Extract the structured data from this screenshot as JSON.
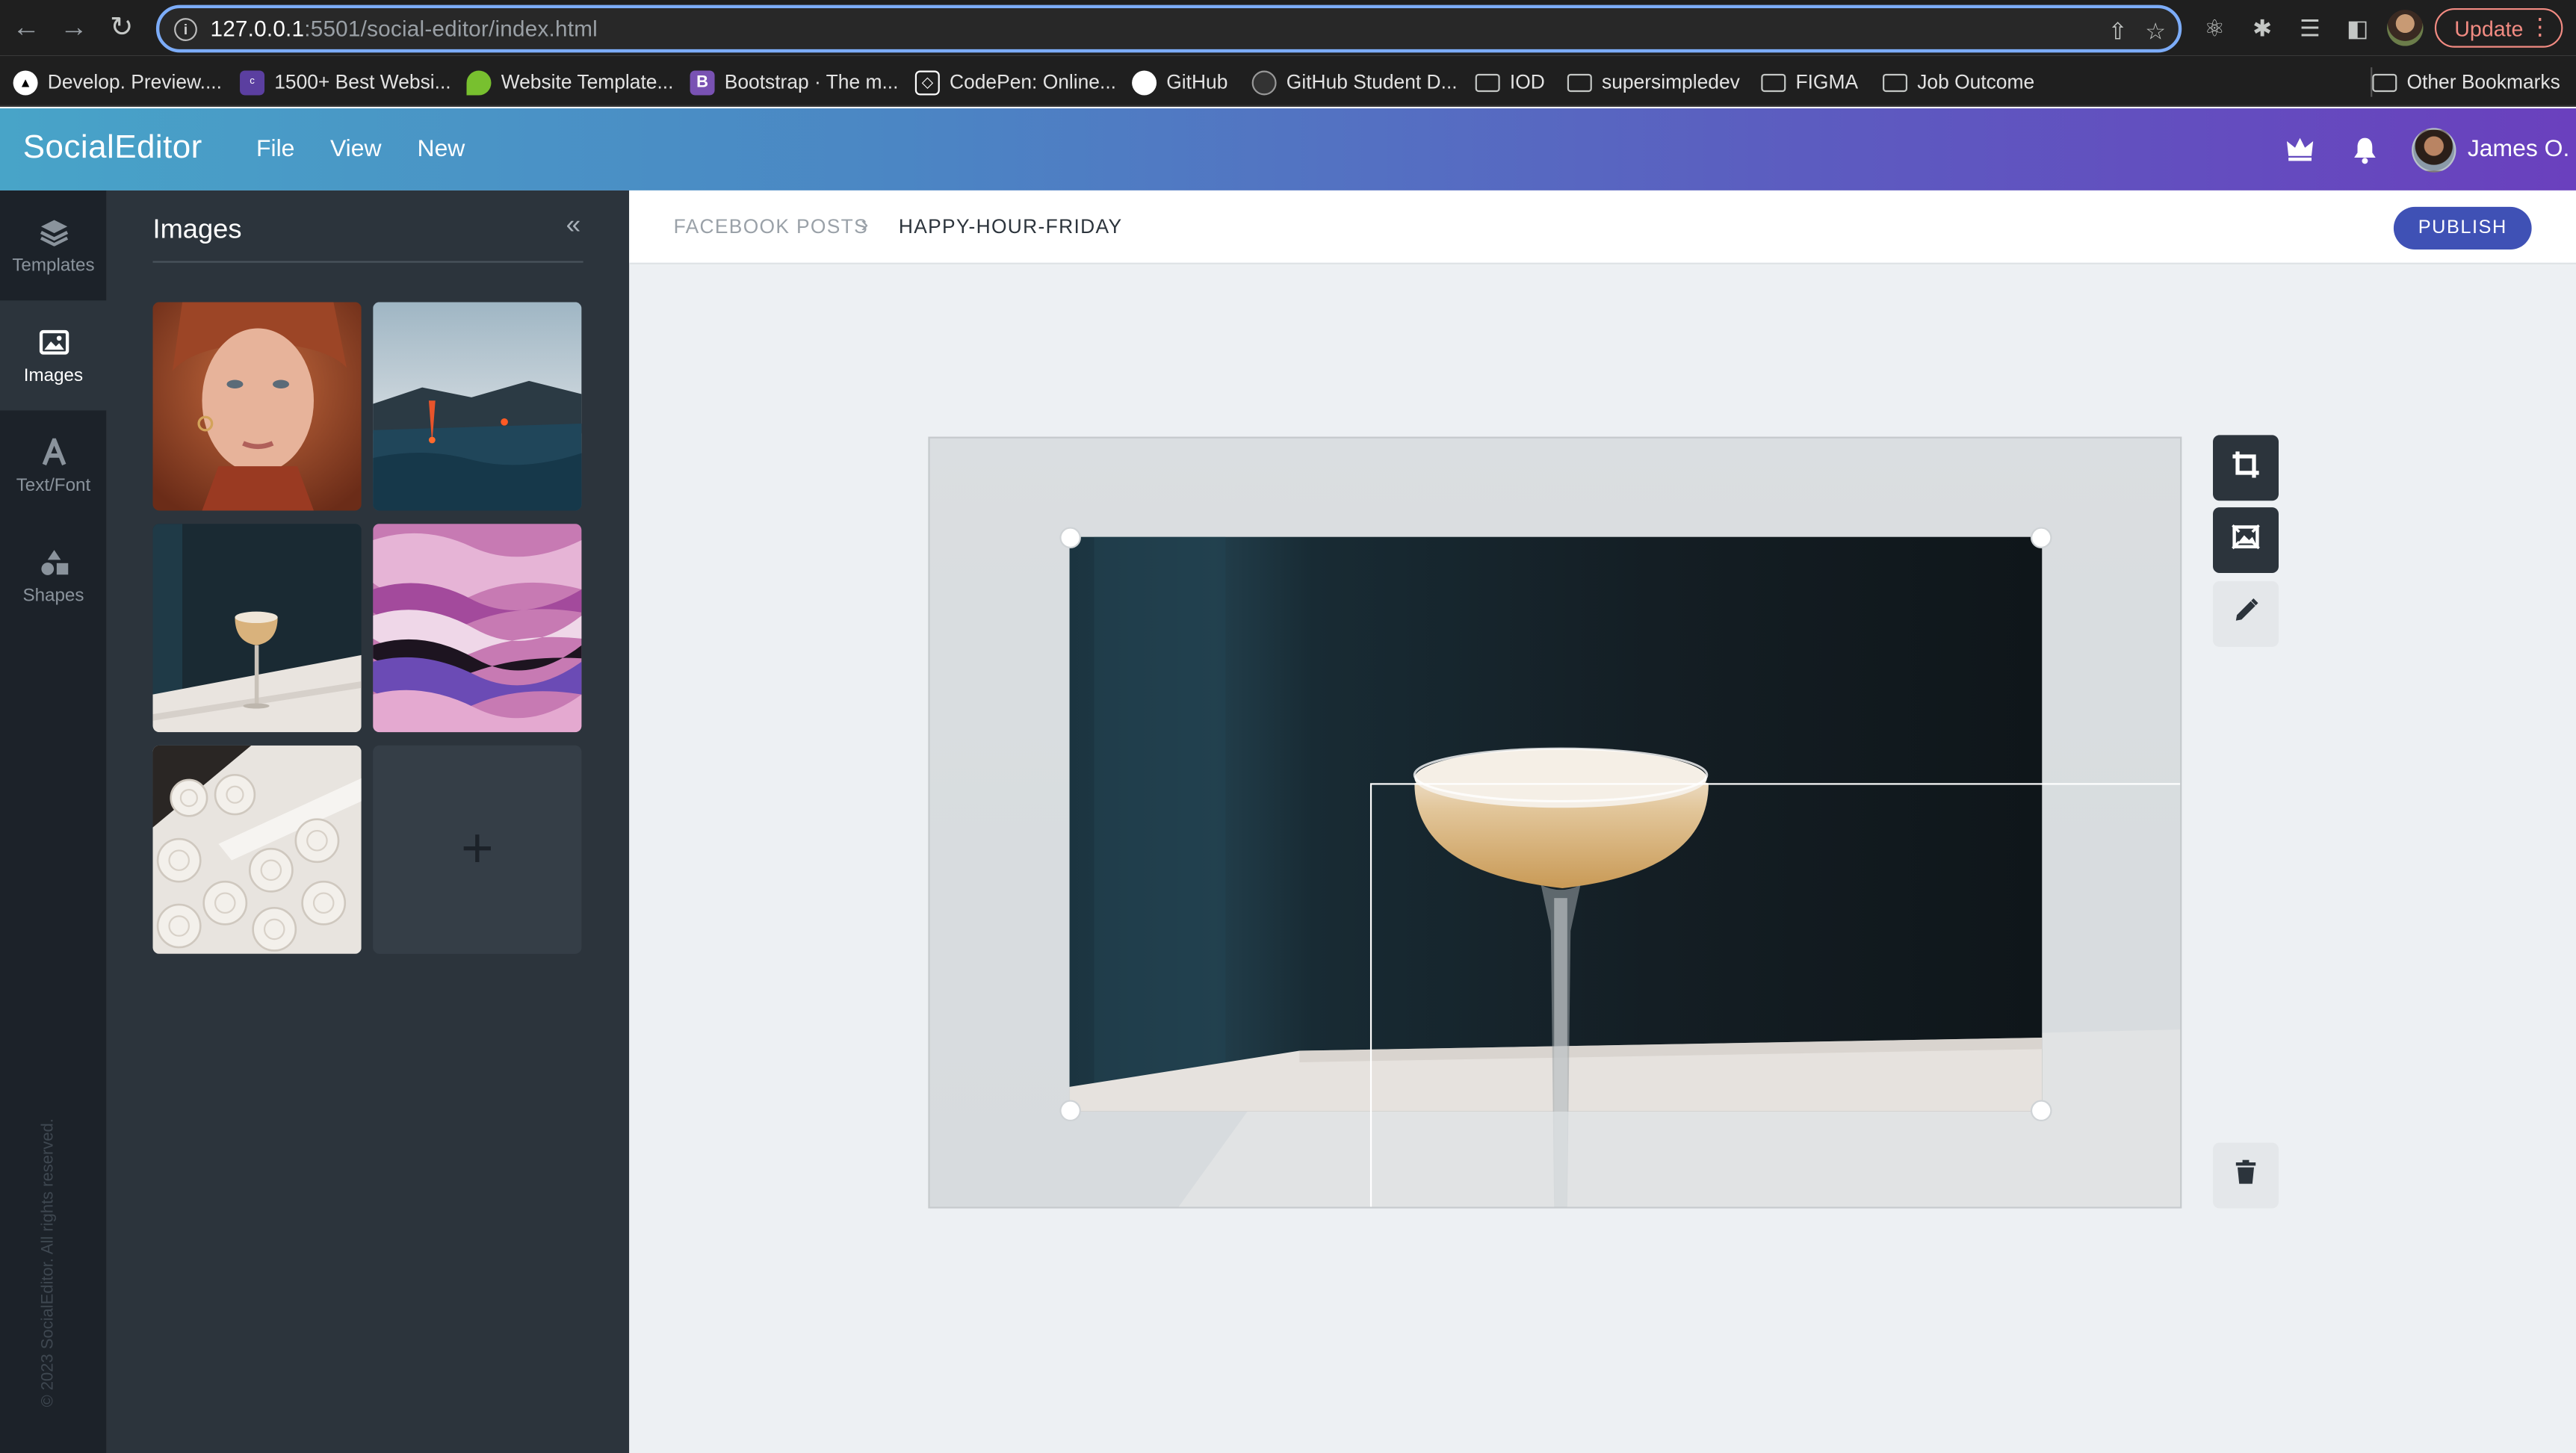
{
  "browser": {
    "url_host": "127.0.0.1",
    "url_path": ":5501/social-editor/index.html",
    "update_label": "Update"
  },
  "bookmarks": [
    {
      "label": "Develop. Preview...."
    },
    {
      "label": "1500+ Best Websi..."
    },
    {
      "label": "Website Template..."
    },
    {
      "label": "Bootstrap · The m..."
    },
    {
      "label": "CodePen: Online..."
    },
    {
      "label": "GitHub"
    },
    {
      "label": "GitHub Student D..."
    },
    {
      "label": "IOD"
    },
    {
      "label": "supersimpledev"
    },
    {
      "label": "FIGMA"
    },
    {
      "label": "Job Outcome"
    },
    {
      "label": "Other Bookmarks"
    }
  ],
  "app": {
    "brand": "SocialEditor",
    "menu": [
      "File",
      "View",
      "New"
    ],
    "user_name": "James O."
  },
  "rail": [
    {
      "label": "Templates",
      "icon": "layers-icon"
    },
    {
      "label": "Images",
      "icon": "image-icon"
    },
    {
      "label": "Text/Font",
      "icon": "text-icon"
    },
    {
      "label": "Shapes",
      "icon": "shapes-icon"
    }
  ],
  "copyright": "© 2023 SocialEditor. All rights reserved.",
  "panel": {
    "title": "Images",
    "thumbnails": [
      "portrait",
      "lava-ocean",
      "cocktail",
      "purple-marble",
      "meringues"
    ],
    "add_symbol": "+"
  },
  "breadcrumb": {
    "parent": "FACEBOOK POSTS",
    "separator": "›",
    "current": "HAPPY-HOUR-FRIDAY"
  },
  "publish_label": "PUBLISH",
  "tools": [
    "crop-icon",
    "replace-image-icon",
    "pencil-icon",
    "trash-icon"
  ],
  "colors": {
    "header_gradient_start": "#48a4c8",
    "header_gradient_end": "#6a40be",
    "sidebar_dark": "#1c2229",
    "panel": "#2c343c",
    "publish": "#3f51b5",
    "omnibox_focus": "#7cacf8"
  }
}
